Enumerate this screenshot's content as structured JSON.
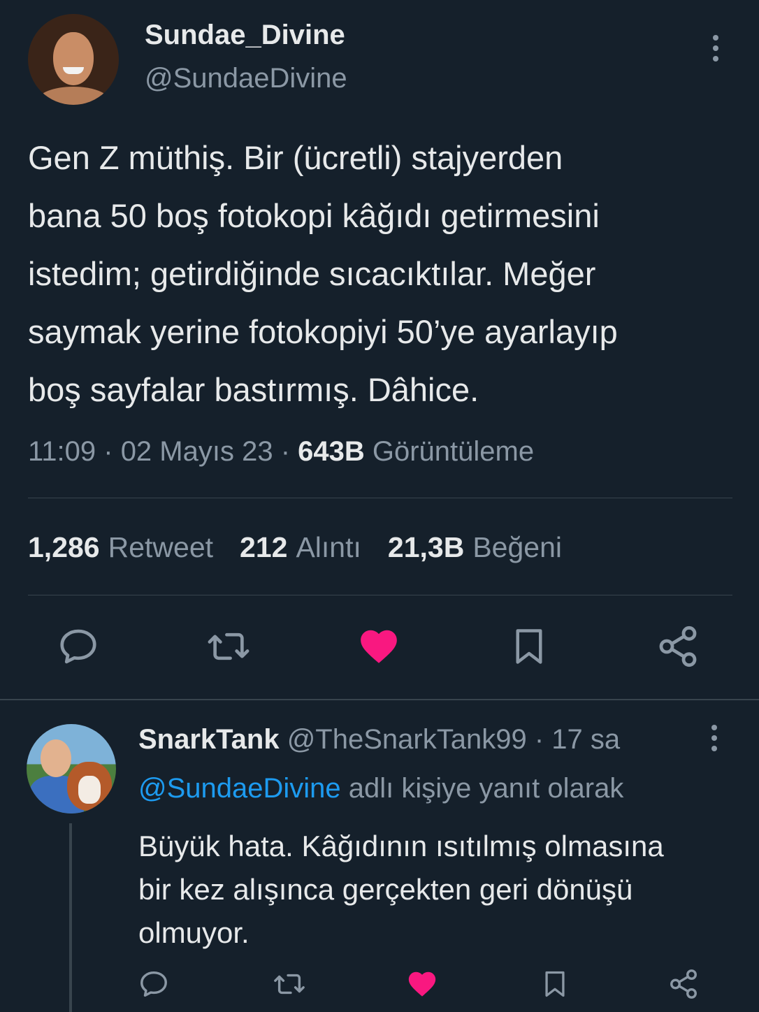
{
  "main_tweet": {
    "display_name": "Sundae_Divine",
    "handle": "@SundaeDivine",
    "text": "Gen Z müthiş. Bir (ücretli) stajyerden\nbana 50 boş fotokopi kâğıdı getirmesini\nistedim; getirdiğinde sıcacıktılar. Meğer\nsaymak yerine fotokopiyi 50’ye ayarlayıp\nboş sayfalar bastırmış. Dâhice.",
    "time": "11:09",
    "sep1": " · ",
    "date": "02 Mayıs 23",
    "sep2": " · ",
    "views_count": "643B",
    "views_label": "Görüntüleme",
    "stats": {
      "retweets_count": "1,286",
      "retweets_label": "Retweet",
      "quotes_count": "212",
      "quotes_label": "Alıntı",
      "likes_count": "21,3B",
      "likes_label": "Beğeni"
    },
    "liked": true,
    "accent_like": "#f91880"
  },
  "reply": {
    "display_name": "SnarkTank",
    "handle": "@TheSnarkTank99",
    "separator": " · ",
    "time_ago": "17 sa",
    "mention": "@SundaeDivine",
    "replying_to_suffix": "adlı kişiye yanıt olarak",
    "text": "Büyük hata. Kâğıdının ısıtılmış olmasına\nbir kez alışınca gerçekten geri dönüşü\nolmuyor.",
    "liked": true
  },
  "icons": {
    "reply": "reply-bubble-icon",
    "retweet": "retweet-icon",
    "like": "heart-icon",
    "bookmark": "bookmark-icon",
    "share": "share-icon",
    "more": "more-options-icon"
  },
  "colors": {
    "background": "#15202b",
    "text_primary": "#e7e9ea",
    "text_secondary": "#8b98a5",
    "link": "#1d9bf0",
    "like": "#f91880"
  }
}
